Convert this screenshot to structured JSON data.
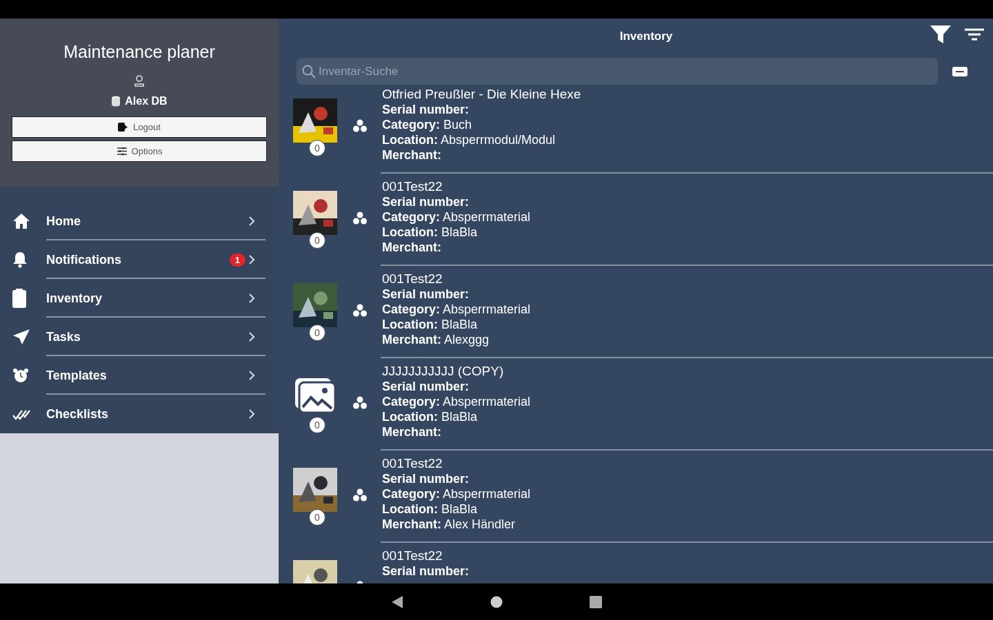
{
  "sidebar": {
    "app_title": "Maintenance planer",
    "user": "Alex DB",
    "buttons": [
      {
        "kind": "logout",
        "label": "Logout"
      },
      {
        "kind": "options",
        "label": "Options"
      }
    ],
    "menu": [
      {
        "kind": "home",
        "label": "Home"
      },
      {
        "kind": "bell",
        "label": "Notifications",
        "badge": "1"
      },
      {
        "kind": "clipboard",
        "label": "Inventory"
      },
      {
        "kind": "send",
        "label": "Tasks"
      },
      {
        "kind": "alarm",
        "label": "Templates"
      },
      {
        "kind": "check",
        "label": "Checklists"
      }
    ]
  },
  "main": {
    "title": "Inventory",
    "search": {
      "placeholder": "Inventar-Suche"
    },
    "items": [
      {
        "title": "Otfried Preußler - Die Kleine Hexe",
        "kind": "picture",
        "count": "0",
        "fields": [
          {
            "label": "Serial number:"
          },
          {
            "label": "Category:",
            "value": "Buch"
          },
          {
            "label": "Location:",
            "value": "Absperrmodul/Modul"
          },
          {
            "label": "Merchant:"
          }
        ]
      },
      {
        "title": "001Test22",
        "kind": "picture",
        "count": "0",
        "fields": [
          {
            "label": "Serial number:"
          },
          {
            "label": "Category:",
            "value": "Absperrmaterial"
          },
          {
            "label": "Location:",
            "value": "BlaBla"
          },
          {
            "label": "Merchant:"
          }
        ]
      },
      {
        "title": "001Test22",
        "kind": "picture",
        "count": "0",
        "fields": [
          {
            "label": "Serial number:"
          },
          {
            "label": "Category:",
            "value": "Absperrmaterial"
          },
          {
            "label": "Location:",
            "value": "BlaBla"
          },
          {
            "label": "Merchant:",
            "value": "Alexggg"
          }
        ]
      },
      {
        "title": "JJJJJJJJJJJ (COPY)",
        "kind": "placeholder",
        "count": "0",
        "fields": [
          {
            "label": "Serial number:"
          },
          {
            "label": "Category:",
            "value": "Absperrmaterial"
          },
          {
            "label": "Location:",
            "value": "BlaBla"
          },
          {
            "label": "Merchant:"
          }
        ]
      },
      {
        "title": "001Test22",
        "kind": "picture",
        "count": "0",
        "fields": [
          {
            "label": "Serial number:"
          },
          {
            "label": "Category:",
            "value": "Absperrmaterial"
          },
          {
            "label": "Location:",
            "value": "BlaBla"
          },
          {
            "label": "Merchant:",
            "value": "Alex Händler"
          }
        ]
      },
      {
        "title": "001Test22",
        "kind": "picture",
        "fields": [
          {
            "label": "Serial number:"
          }
        ]
      }
    ]
  }
}
